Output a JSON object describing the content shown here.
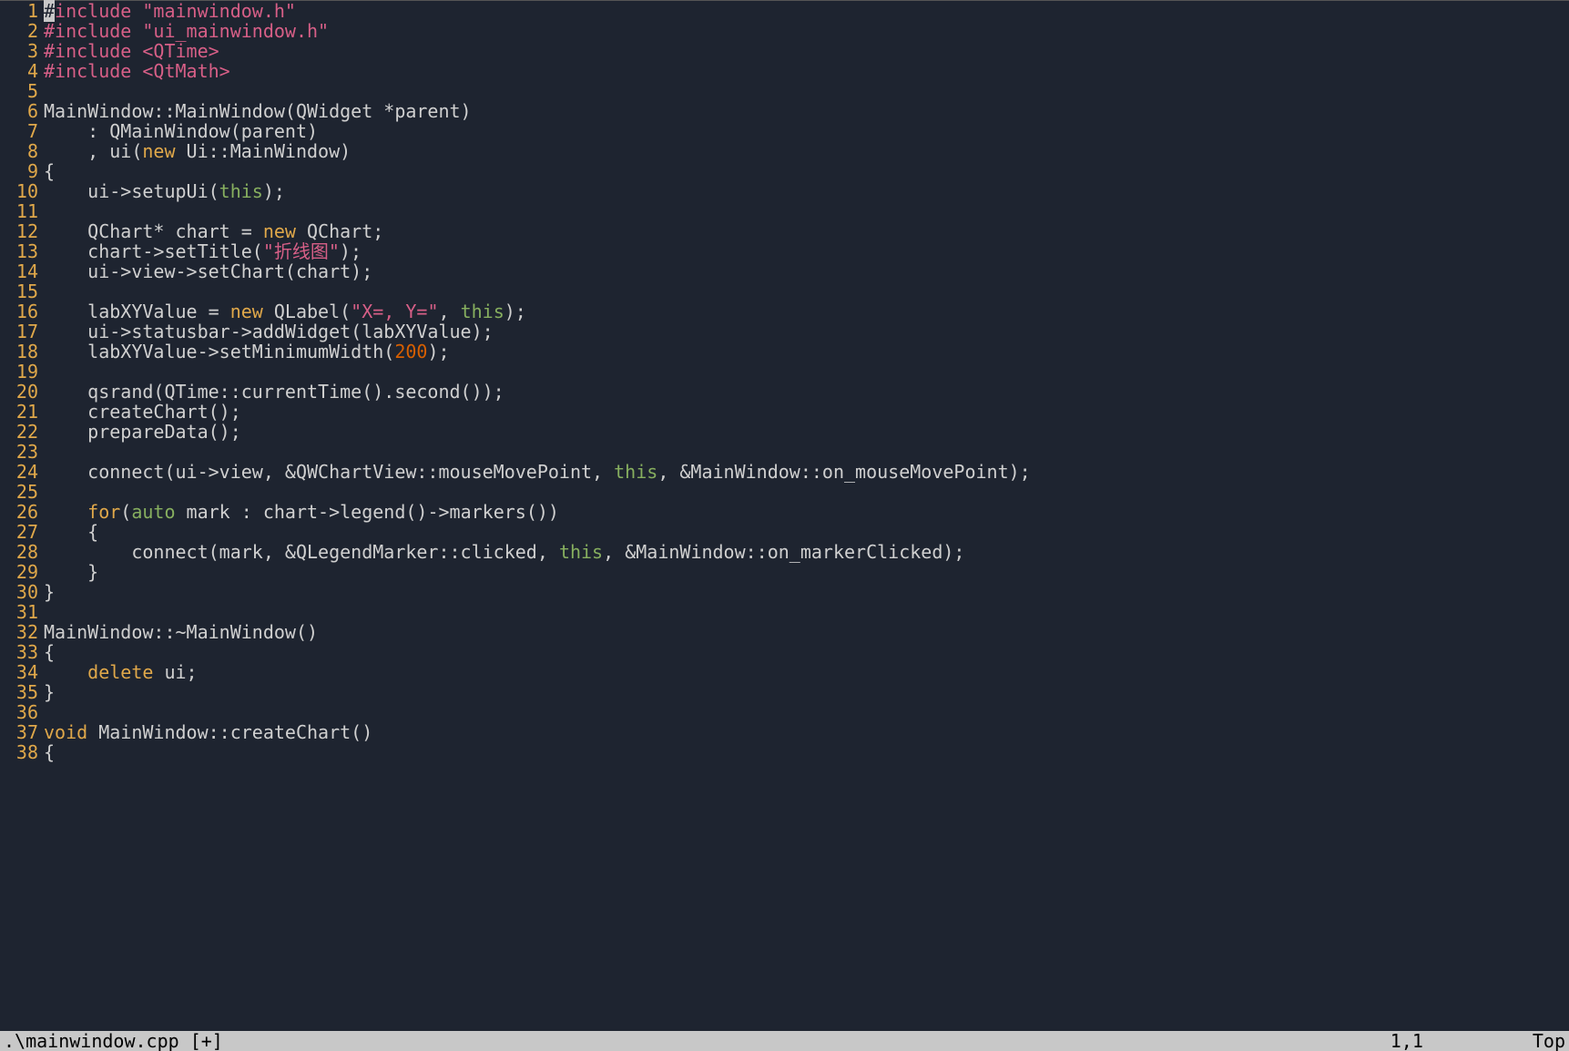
{
  "status": {
    "filename": ".\\mainwindow.cpp [+]",
    "position": "1,1",
    "scroll": "Top"
  },
  "code_lines": [
    {
      "n": 1,
      "tokens": [
        {
          "t": "#include ",
          "c": "pp"
        },
        {
          "t": "\"mainwindow.h\"",
          "c": "str"
        }
      ],
      "cursor_at": 0
    },
    {
      "n": 2,
      "tokens": [
        {
          "t": "#include ",
          "c": "pp"
        },
        {
          "t": "\"ui_mainwindow.h\"",
          "c": "str"
        }
      ]
    },
    {
      "n": 3,
      "tokens": [
        {
          "t": "#include ",
          "c": "pp"
        },
        {
          "t": "<QTime>",
          "c": "str"
        }
      ]
    },
    {
      "n": 4,
      "tokens": [
        {
          "t": "#include ",
          "c": "pp"
        },
        {
          "t": "<QtMath>",
          "c": "str"
        }
      ]
    },
    {
      "n": 5,
      "tokens": [
        {
          "t": "",
          "c": "txt"
        }
      ]
    },
    {
      "n": 6,
      "tokens": [
        {
          "t": "MainWindow::MainWindow(QWidget *parent)",
          "c": "txt"
        }
      ]
    },
    {
      "n": 7,
      "tokens": [
        {
          "t": "    : QMainWindow(parent)",
          "c": "txt"
        }
      ]
    },
    {
      "n": 8,
      "tokens": [
        {
          "t": "    , ui(",
          "c": "txt"
        },
        {
          "t": "new",
          "c": "kw"
        },
        {
          "t": " Ui::MainWindow)",
          "c": "txt"
        }
      ]
    },
    {
      "n": 9,
      "tokens": [
        {
          "t": "{",
          "c": "txt"
        }
      ]
    },
    {
      "n": 10,
      "tokens": [
        {
          "t": "    ui->setupUi(",
          "c": "txt"
        },
        {
          "t": "this",
          "c": "ty"
        },
        {
          "t": ");",
          "c": "txt"
        }
      ]
    },
    {
      "n": 11,
      "tokens": [
        {
          "t": "",
          "c": "txt"
        }
      ]
    },
    {
      "n": 12,
      "tokens": [
        {
          "t": "    QChart* chart = ",
          "c": "txt"
        },
        {
          "t": "new",
          "c": "kw"
        },
        {
          "t": " QChart;",
          "c": "txt"
        }
      ]
    },
    {
      "n": 13,
      "tokens": [
        {
          "t": "    chart->setTitle(",
          "c": "txt"
        },
        {
          "t": "\"折线图\"",
          "c": "str"
        },
        {
          "t": ");",
          "c": "txt"
        }
      ]
    },
    {
      "n": 14,
      "tokens": [
        {
          "t": "    ui->view->setChart(chart);",
          "c": "txt"
        }
      ]
    },
    {
      "n": 15,
      "tokens": [
        {
          "t": "",
          "c": "txt"
        }
      ]
    },
    {
      "n": 16,
      "tokens": [
        {
          "t": "    labXYValue = ",
          "c": "txt"
        },
        {
          "t": "new",
          "c": "kw"
        },
        {
          "t": " QLabel(",
          "c": "txt"
        },
        {
          "t": "\"X=, Y=\"",
          "c": "str"
        },
        {
          "t": ", ",
          "c": "txt"
        },
        {
          "t": "this",
          "c": "ty"
        },
        {
          "t": ");",
          "c": "txt"
        }
      ]
    },
    {
      "n": 17,
      "tokens": [
        {
          "t": "    ui->statusbar->addWidget(labXYValue);",
          "c": "txt"
        }
      ]
    },
    {
      "n": 18,
      "tokens": [
        {
          "t": "    labXYValue->setMinimumWidth(",
          "c": "txt"
        },
        {
          "t": "200",
          "c": "num"
        },
        {
          "t": ");",
          "c": "txt"
        }
      ]
    },
    {
      "n": 19,
      "tokens": [
        {
          "t": "",
          "c": "txt"
        }
      ]
    },
    {
      "n": 20,
      "tokens": [
        {
          "t": "    qsrand(QTime::currentTime().second());",
          "c": "txt"
        }
      ]
    },
    {
      "n": 21,
      "tokens": [
        {
          "t": "    createChart();",
          "c": "txt"
        }
      ]
    },
    {
      "n": 22,
      "tokens": [
        {
          "t": "    prepareData();",
          "c": "txt"
        }
      ]
    },
    {
      "n": 23,
      "tokens": [
        {
          "t": "",
          "c": "txt"
        }
      ]
    },
    {
      "n": 24,
      "tokens": [
        {
          "t": "    connect(ui->view, &QWChartView::mouseMovePoint, ",
          "c": "txt"
        },
        {
          "t": "this",
          "c": "ty"
        },
        {
          "t": ", &MainWindow::on_mouseMovePoint);",
          "c": "txt"
        }
      ]
    },
    {
      "n": 25,
      "tokens": [
        {
          "t": "",
          "c": "txt"
        }
      ]
    },
    {
      "n": 26,
      "tokens": [
        {
          "t": "    ",
          "c": "txt"
        },
        {
          "t": "for",
          "c": "kw"
        },
        {
          "t": "(",
          "c": "txt"
        },
        {
          "t": "auto",
          "c": "ty"
        },
        {
          "t": " mark : chart->legend()->markers())",
          "c": "txt"
        }
      ]
    },
    {
      "n": 27,
      "tokens": [
        {
          "t": "    {",
          "c": "txt"
        }
      ]
    },
    {
      "n": 28,
      "tokens": [
        {
          "t": "        connect(mark, &QLegendMarker::clicked, ",
          "c": "txt"
        },
        {
          "t": "this",
          "c": "ty"
        },
        {
          "t": ", &MainWindow::on_markerClicked);",
          "c": "txt"
        }
      ]
    },
    {
      "n": 29,
      "tokens": [
        {
          "t": "    }",
          "c": "txt"
        }
      ]
    },
    {
      "n": 30,
      "tokens": [
        {
          "t": "}",
          "c": "txt"
        }
      ]
    },
    {
      "n": 31,
      "tokens": [
        {
          "t": "",
          "c": "txt"
        }
      ]
    },
    {
      "n": 32,
      "tokens": [
        {
          "t": "MainWindow::~MainWindow()",
          "c": "txt"
        }
      ]
    },
    {
      "n": 33,
      "tokens": [
        {
          "t": "{",
          "c": "txt"
        }
      ]
    },
    {
      "n": 34,
      "tokens": [
        {
          "t": "    ",
          "c": "txt"
        },
        {
          "t": "delete",
          "c": "kw"
        },
        {
          "t": " ui;",
          "c": "txt"
        }
      ]
    },
    {
      "n": 35,
      "tokens": [
        {
          "t": "}",
          "c": "txt"
        }
      ]
    },
    {
      "n": 36,
      "tokens": [
        {
          "t": "",
          "c": "txt"
        }
      ]
    },
    {
      "n": 37,
      "tokens": [
        {
          "t": "void",
          "c": "kw"
        },
        {
          "t": " MainWindow::createChart()",
          "c": "txt"
        }
      ]
    },
    {
      "n": 38,
      "tokens": [
        {
          "t": "{",
          "c": "txt"
        }
      ]
    }
  ]
}
